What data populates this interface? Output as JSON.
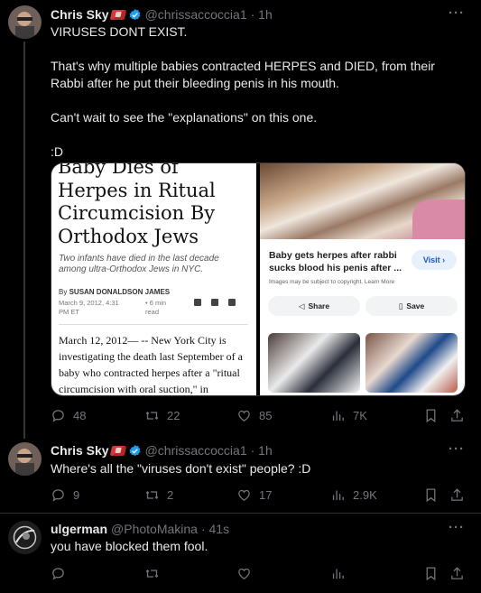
{
  "tweet1": {
    "name": "Chris Sky",
    "handle": "@chrissaccoccia1",
    "time": "· 1h",
    "lines": [
      "VIRUSES DONT EXIST.",
      "That's why multiple babies contracted HERPES and DIED, from their Rabbi after he put their bleeding penis in his mouth.",
      "Can't wait to see the \"explanations\" on this one.",
      ":D"
    ],
    "article": {
      "headline": "Baby Dies of Herpes in Ritual Circumcision By Orthodox Jews",
      "subhead": "Two infants have died in the last decade among ultra-Orthodox Jews in NYC.",
      "by_prefix": "By",
      "author": "SUSAN DONALDSON JAMES",
      "date": "March 9, 2012, 4:31 PM ET",
      "read": "• 6 min read",
      "body": "March 12, 2012— -- New York City is investigating the death last September of a baby who contracted herpes after a \"ritual circumcision with oral suction,\" in"
    },
    "search_card": {
      "title": "Baby gets herpes after rabbi sucks blood his penis after ...",
      "visit": "Visit ›",
      "note": "Images may be subject to copyright. Learn More",
      "share": "Share",
      "save": "Save"
    },
    "stats": {
      "replies": "48",
      "retweets": "22",
      "likes": "85",
      "views": "7K"
    }
  },
  "tweet2": {
    "name": "Chris Sky",
    "handle": "@chrissaccoccia1",
    "time": "· 1h",
    "text": "Where's all the \"viruses don't exist\" people? :D",
    "stats": {
      "replies": "9",
      "retweets": "2",
      "likes": "17",
      "views": "2.9K"
    }
  },
  "tweet3": {
    "name": "ulgerman",
    "handle": "@PhotoMakina",
    "time": "· 41s",
    "text": "you have blocked them fool."
  },
  "more_label": "···",
  "colors": {
    "background": "#000000",
    "text": "#e7e9ea",
    "muted": "#71767b",
    "verified": "#1d9bf0"
  },
  "icons": [
    "reply-icon",
    "retweet-icon",
    "like-icon",
    "views-icon",
    "bookmark-icon",
    "share-icon",
    "verified-icon",
    "flag-icon"
  ]
}
